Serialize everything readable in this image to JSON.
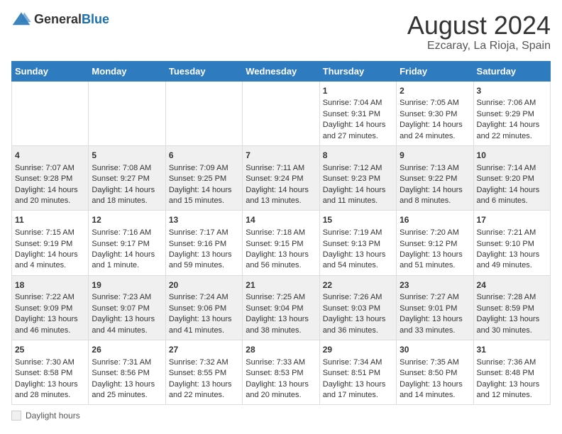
{
  "header": {
    "logo_general": "General",
    "logo_blue": "Blue",
    "title": "August 2024",
    "subtitle": "Ezcaray, La Rioja, Spain"
  },
  "columns": [
    "Sunday",
    "Monday",
    "Tuesday",
    "Wednesday",
    "Thursday",
    "Friday",
    "Saturday"
  ],
  "weeks": [
    [
      {
        "day": "",
        "sunrise": "",
        "sunset": "",
        "daylight": ""
      },
      {
        "day": "",
        "sunrise": "",
        "sunset": "",
        "daylight": ""
      },
      {
        "day": "",
        "sunrise": "",
        "sunset": "",
        "daylight": ""
      },
      {
        "day": "",
        "sunrise": "",
        "sunset": "",
        "daylight": ""
      },
      {
        "day": "1",
        "sunrise": "Sunrise: 7:04 AM",
        "sunset": "Sunset: 9:31 PM",
        "daylight": "Daylight: 14 hours and 27 minutes."
      },
      {
        "day": "2",
        "sunrise": "Sunrise: 7:05 AM",
        "sunset": "Sunset: 9:30 PM",
        "daylight": "Daylight: 14 hours and 24 minutes."
      },
      {
        "day": "3",
        "sunrise": "Sunrise: 7:06 AM",
        "sunset": "Sunset: 9:29 PM",
        "daylight": "Daylight: 14 hours and 22 minutes."
      }
    ],
    [
      {
        "day": "4",
        "sunrise": "Sunrise: 7:07 AM",
        "sunset": "Sunset: 9:28 PM",
        "daylight": "Daylight: 14 hours and 20 minutes."
      },
      {
        "day": "5",
        "sunrise": "Sunrise: 7:08 AM",
        "sunset": "Sunset: 9:27 PM",
        "daylight": "Daylight: 14 hours and 18 minutes."
      },
      {
        "day": "6",
        "sunrise": "Sunrise: 7:09 AM",
        "sunset": "Sunset: 9:25 PM",
        "daylight": "Daylight: 14 hours and 15 minutes."
      },
      {
        "day": "7",
        "sunrise": "Sunrise: 7:11 AM",
        "sunset": "Sunset: 9:24 PM",
        "daylight": "Daylight: 14 hours and 13 minutes."
      },
      {
        "day": "8",
        "sunrise": "Sunrise: 7:12 AM",
        "sunset": "Sunset: 9:23 PM",
        "daylight": "Daylight: 14 hours and 11 minutes."
      },
      {
        "day": "9",
        "sunrise": "Sunrise: 7:13 AM",
        "sunset": "Sunset: 9:22 PM",
        "daylight": "Daylight: 14 hours and 8 minutes."
      },
      {
        "day": "10",
        "sunrise": "Sunrise: 7:14 AM",
        "sunset": "Sunset: 9:20 PM",
        "daylight": "Daylight: 14 hours and 6 minutes."
      }
    ],
    [
      {
        "day": "11",
        "sunrise": "Sunrise: 7:15 AM",
        "sunset": "Sunset: 9:19 PM",
        "daylight": "Daylight: 14 hours and 4 minutes."
      },
      {
        "day": "12",
        "sunrise": "Sunrise: 7:16 AM",
        "sunset": "Sunset: 9:17 PM",
        "daylight": "Daylight: 14 hours and 1 minute."
      },
      {
        "day": "13",
        "sunrise": "Sunrise: 7:17 AM",
        "sunset": "Sunset: 9:16 PM",
        "daylight": "Daylight: 13 hours and 59 minutes."
      },
      {
        "day": "14",
        "sunrise": "Sunrise: 7:18 AM",
        "sunset": "Sunset: 9:15 PM",
        "daylight": "Daylight: 13 hours and 56 minutes."
      },
      {
        "day": "15",
        "sunrise": "Sunrise: 7:19 AM",
        "sunset": "Sunset: 9:13 PM",
        "daylight": "Daylight: 13 hours and 54 minutes."
      },
      {
        "day": "16",
        "sunrise": "Sunrise: 7:20 AM",
        "sunset": "Sunset: 9:12 PM",
        "daylight": "Daylight: 13 hours and 51 minutes."
      },
      {
        "day": "17",
        "sunrise": "Sunrise: 7:21 AM",
        "sunset": "Sunset: 9:10 PM",
        "daylight": "Daylight: 13 hours and 49 minutes."
      }
    ],
    [
      {
        "day": "18",
        "sunrise": "Sunrise: 7:22 AM",
        "sunset": "Sunset: 9:09 PM",
        "daylight": "Daylight: 13 hours and 46 minutes."
      },
      {
        "day": "19",
        "sunrise": "Sunrise: 7:23 AM",
        "sunset": "Sunset: 9:07 PM",
        "daylight": "Daylight: 13 hours and 44 minutes."
      },
      {
        "day": "20",
        "sunrise": "Sunrise: 7:24 AM",
        "sunset": "Sunset: 9:06 PM",
        "daylight": "Daylight: 13 hours and 41 minutes."
      },
      {
        "day": "21",
        "sunrise": "Sunrise: 7:25 AM",
        "sunset": "Sunset: 9:04 PM",
        "daylight": "Daylight: 13 hours and 38 minutes."
      },
      {
        "day": "22",
        "sunrise": "Sunrise: 7:26 AM",
        "sunset": "Sunset: 9:03 PM",
        "daylight": "Daylight: 13 hours and 36 minutes."
      },
      {
        "day": "23",
        "sunrise": "Sunrise: 7:27 AM",
        "sunset": "Sunset: 9:01 PM",
        "daylight": "Daylight: 13 hours and 33 minutes."
      },
      {
        "day": "24",
        "sunrise": "Sunrise: 7:28 AM",
        "sunset": "Sunset: 8:59 PM",
        "daylight": "Daylight: 13 hours and 30 minutes."
      }
    ],
    [
      {
        "day": "25",
        "sunrise": "Sunrise: 7:30 AM",
        "sunset": "Sunset: 8:58 PM",
        "daylight": "Daylight: 13 hours and 28 minutes."
      },
      {
        "day": "26",
        "sunrise": "Sunrise: 7:31 AM",
        "sunset": "Sunset: 8:56 PM",
        "daylight": "Daylight: 13 hours and 25 minutes."
      },
      {
        "day": "27",
        "sunrise": "Sunrise: 7:32 AM",
        "sunset": "Sunset: 8:55 PM",
        "daylight": "Daylight: 13 hours and 22 minutes."
      },
      {
        "day": "28",
        "sunrise": "Sunrise: 7:33 AM",
        "sunset": "Sunset: 8:53 PM",
        "daylight": "Daylight: 13 hours and 20 minutes."
      },
      {
        "day": "29",
        "sunrise": "Sunrise: 7:34 AM",
        "sunset": "Sunset: 8:51 PM",
        "daylight": "Daylight: 13 hours and 17 minutes."
      },
      {
        "day": "30",
        "sunrise": "Sunrise: 7:35 AM",
        "sunset": "Sunset: 8:50 PM",
        "daylight": "Daylight: 13 hours and 14 minutes."
      },
      {
        "day": "31",
        "sunrise": "Sunrise: 7:36 AM",
        "sunset": "Sunset: 8:48 PM",
        "daylight": "Daylight: 13 hours and 12 minutes."
      }
    ]
  ],
  "footer": {
    "daylight_label": "Daylight hours"
  }
}
